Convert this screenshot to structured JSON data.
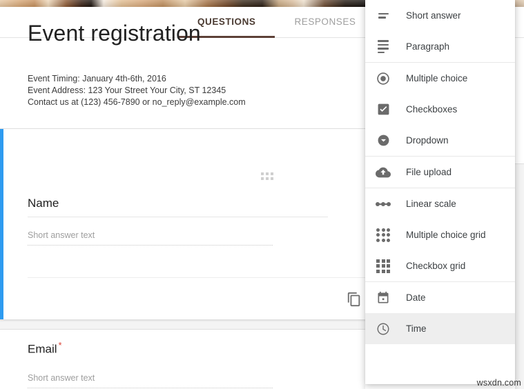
{
  "header": {
    "tabs": [
      {
        "label": "QUESTIONS",
        "active": true
      },
      {
        "label": "RESPONSES",
        "active": false
      }
    ],
    "active_tab_underline_color": "#5d4037"
  },
  "form": {
    "title": "Event registration",
    "description_lines": [
      "Event Timing: January 4th-6th, 2016",
      "Event Address: 123 Your Street Your City, ST 12345",
      "Contact us at (123) 456-7890 or no_reply@example.com"
    ]
  },
  "questions": [
    {
      "title": "Name",
      "answer_placeholder": "Short answer text",
      "required": false,
      "active": true,
      "accent_color": "#2e9bf0",
      "drag_handle_icon": "drag-grid-icon",
      "duplicate_icon": "copy-icon"
    },
    {
      "title": "Email",
      "required_marker": "*",
      "answer_placeholder": "Short answer text",
      "required": true,
      "active": false
    }
  ],
  "question_type_menu": {
    "hovered_item": "Time",
    "groups": [
      {
        "items": [
          {
            "label": "Short answer",
            "icon": "short-answer-icon"
          },
          {
            "label": "Paragraph",
            "icon": "paragraph-icon"
          }
        ]
      },
      {
        "items": [
          {
            "label": "Multiple choice",
            "icon": "radio-button-icon"
          },
          {
            "label": "Checkboxes",
            "icon": "checkbox-icon"
          },
          {
            "label": "Dropdown",
            "icon": "dropdown-circle-icon"
          }
        ]
      },
      {
        "items": [
          {
            "label": "File upload",
            "icon": "cloud-upload-icon"
          }
        ]
      },
      {
        "items": [
          {
            "label": "Linear scale",
            "icon": "linear-scale-icon"
          },
          {
            "label": "Multiple choice grid",
            "icon": "radio-grid-icon"
          },
          {
            "label": "Checkbox grid",
            "icon": "checkbox-grid-icon"
          }
        ]
      },
      {
        "items": [
          {
            "label": "Date",
            "icon": "calendar-icon"
          },
          {
            "label": "Time",
            "icon": "clock-icon"
          }
        ]
      }
    ]
  },
  "watermark": {
    "text": "wsxdn.com"
  }
}
